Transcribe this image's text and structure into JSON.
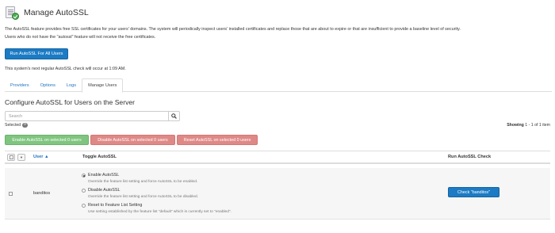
{
  "header": {
    "title": "Manage AutoSSL",
    "icon": "certificate-icon"
  },
  "description": {
    "line1": "The AutoSSL feature provides free SSL certificates for your users' domains. The system will periodically inspect users' installed certificates and replace those that are about to expire or that are insufficient to provide a baseline level of security.",
    "line2": "Users who do not have the \"autossl\" feature will not receive the free certificates."
  },
  "run_all_button": "Run AutoSSL For All Users",
  "next_check": "This system's next regular AutoSSL check will occur at 1:09 AM.",
  "tabs": [
    {
      "label": "Providers",
      "active": false
    },
    {
      "label": "Options",
      "active": false
    },
    {
      "label": "Logs",
      "active": false
    },
    {
      "label": "Manage Users",
      "active": true
    }
  ],
  "section_title": "Configure AutoSSL for Users on the Server",
  "search": {
    "placeholder": "Search",
    "value": "",
    "icon": "search-icon"
  },
  "selected": {
    "label": "Selected",
    "count": "0"
  },
  "showing": {
    "prefix": "Showing ",
    "range": "1 - 1 of 1 item"
  },
  "bulk_actions": {
    "enable": "Enable AutoSSL on selected 0 users",
    "disable": "Disable AutoSSL on selected 0 users",
    "reset": "Reset AutoSSL on selected 0 users"
  },
  "table": {
    "headers": {
      "user": "User ▲",
      "toggle": "Toggle AutoSSL",
      "run": "Run AutoSSL Check"
    },
    "rows": [
      {
        "user": "banditos",
        "options": [
          {
            "label": "Enable AutoSSL",
            "help": "Override the feature list setting and force AutoSSL to be enabled.",
            "selected": true
          },
          {
            "label": "Disable AutoSSL",
            "help": "Override the feature list setting and force AutoSSL to be disabled.",
            "selected": false
          },
          {
            "label": "Reset to Feature List Setting",
            "help": "Use setting established by the feature list \"default\" which is currently set to \"enabled\".",
            "selected": false
          }
        ],
        "check_button": "Check \"banditos\""
      }
    ]
  },
  "colors": {
    "primary": "#1c7bc4",
    "success": "#7fc57f",
    "danger": "#df8987",
    "link": "#1e73be"
  }
}
